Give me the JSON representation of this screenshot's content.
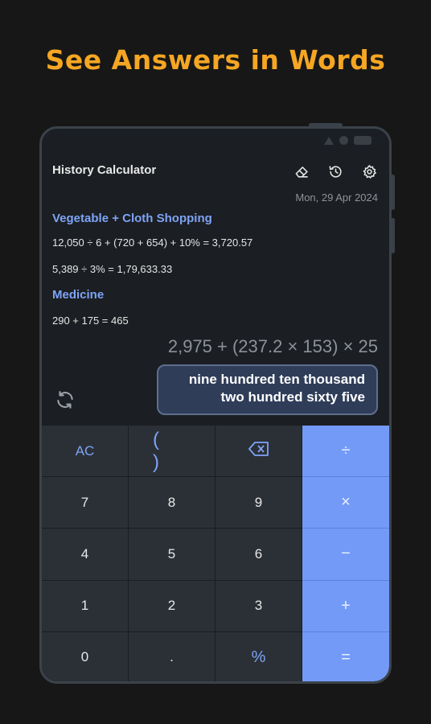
{
  "headline": "See Answers in Words",
  "app": {
    "title": "History Calculator",
    "date": "Mon, 29 Apr 2024",
    "icons": [
      "eraser-icon",
      "history-icon",
      "settings-gear-icon"
    ]
  },
  "history": [
    {
      "category": "Vegetable + Cloth Shopping"
    },
    {
      "line": "12,050 ÷ 6 + (720 + 654) + 10% = 3,720.57"
    },
    {
      "line": "5,389 ÷ 3% = 1,79,633.33"
    },
    {
      "category": "Medicine"
    },
    {
      "line": "290 + 175 = 465"
    }
  ],
  "expression": "2,975 + (237.2 × 153) × 25",
  "answer_words": {
    "line1": "nine hundred ten thousand",
    "line2": "two hundred sixty five"
  },
  "keypad": {
    "ac": "AC",
    "paren": "( )",
    "backspace_icon": "backspace-icon",
    "divide": "÷",
    "seven": "7",
    "eight": "8",
    "nine": "9",
    "multiply": "×",
    "four": "4",
    "five": "5",
    "six": "6",
    "minus": "−",
    "one": "1",
    "two": "2",
    "three": "3",
    "plus": "+",
    "zero": "0",
    "dot": ".",
    "percent": "%",
    "equals": "="
  },
  "colors": {
    "headline": "#f5a623",
    "accent": "#739af6",
    "category": "#7ea4f6",
    "answer_bg": "#2f3d59"
  }
}
